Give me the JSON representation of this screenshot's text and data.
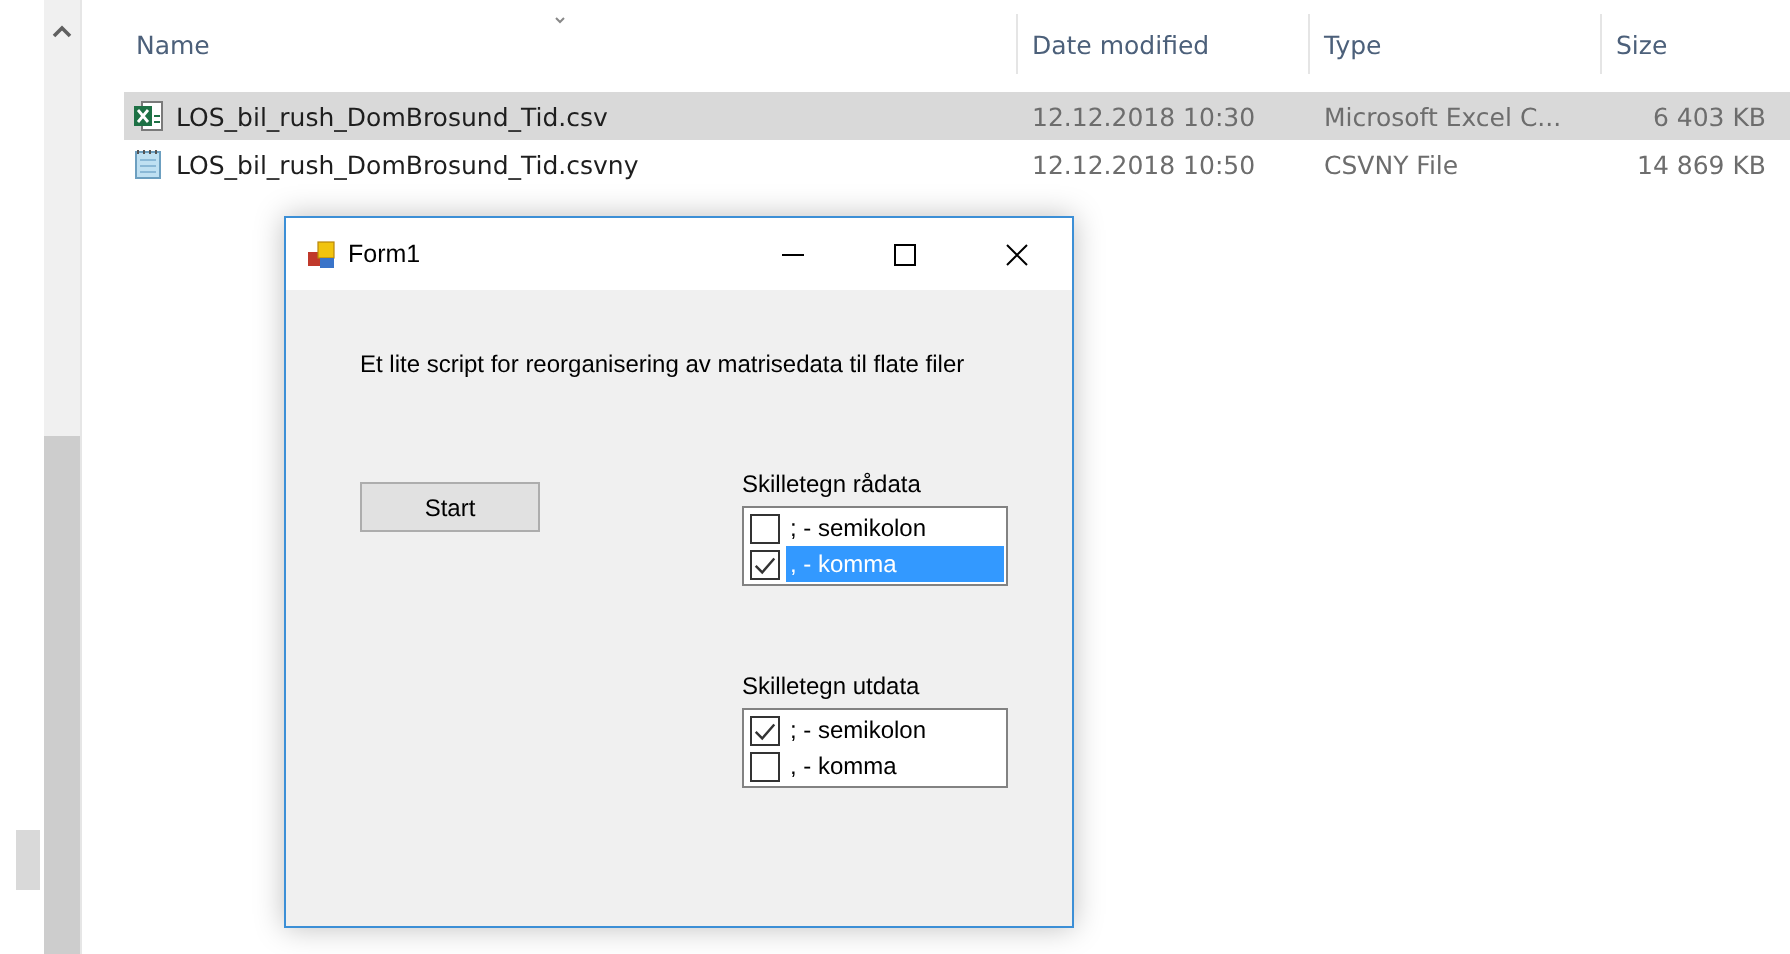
{
  "explorer": {
    "columns": [
      "Name",
      "Date modified",
      "Type",
      "Size"
    ],
    "files": [
      {
        "kind": "excel",
        "name": "LOS_bil_rush_DomBrosund_Tid.csv",
        "date": "12.12.2018 10:30",
        "type": "Microsoft Excel C...",
        "size": "6 403 KB",
        "selected": true
      },
      {
        "kind": "text",
        "name": "LOS_bil_rush_DomBrosund_Tid.csvny",
        "date": "12.12.2018 10:50",
        "type": "CSVNY File",
        "size": "14 869 KB",
        "selected": false
      }
    ]
  },
  "form": {
    "title": "Form1",
    "description": "Et lite script for reorganisering av matrisedata til flate filer",
    "button": "Start",
    "groups": [
      {
        "label": "Skilletegn rådata",
        "options": [
          {
            "label": "; - semikolon",
            "checked": false,
            "selected": false
          },
          {
            "label": ", - komma",
            "checked": true,
            "selected": true
          }
        ]
      },
      {
        "label": "Skilletegn utdata",
        "options": [
          {
            "label": "; - semikolon",
            "checked": true,
            "selected": false
          },
          {
            "label": ", - komma",
            "checked": false,
            "selected": false
          }
        ]
      }
    ]
  }
}
